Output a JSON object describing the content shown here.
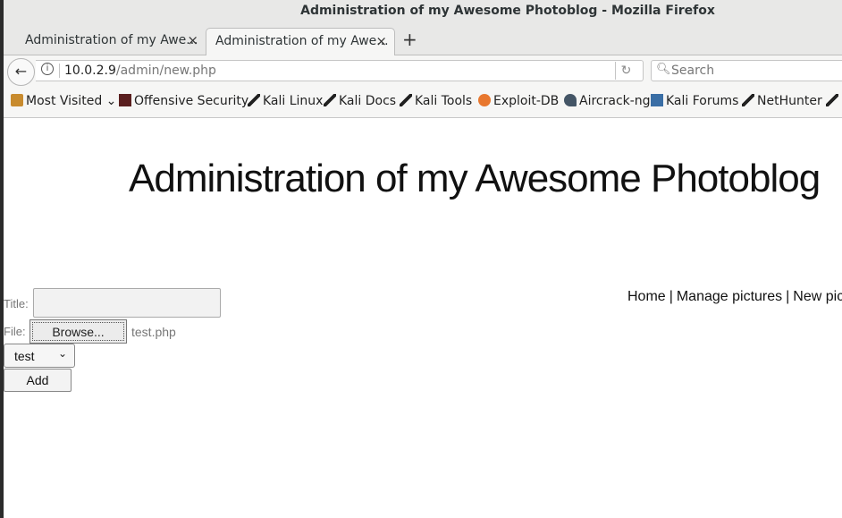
{
  "window": {
    "title": "Administration of my Awesome Photoblog - Mozilla Firefox"
  },
  "tabs": [
    {
      "label": "Administration of my Awe...",
      "active": false
    },
    {
      "label": "Administration of my Awe...",
      "active": true
    }
  ],
  "tab_close_glyph": "×",
  "new_tab_glyph": "+",
  "navbar": {
    "url_host": "10.0.2.9",
    "url_path": "/admin/new.php",
    "search_placeholder": "Search"
  },
  "bookmarks": [
    {
      "label": "Most Visited",
      "icon": "folder-icon",
      "dropdown": true
    },
    {
      "label": "Offensive Security",
      "icon": "offsec-icon"
    },
    {
      "label": "Kali Linux",
      "icon": "kali-dragon-icon"
    },
    {
      "label": "Kali Docs",
      "icon": "kali-dragon-icon"
    },
    {
      "label": "Kali Tools",
      "icon": "kali-dragon-icon"
    },
    {
      "label": "Exploit-DB",
      "icon": "exploitdb-icon"
    },
    {
      "label": "Aircrack-ng",
      "icon": "aircrack-icon"
    },
    {
      "label": "Kali Forums",
      "icon": "kali-forums-icon"
    },
    {
      "label": "NetHunter",
      "icon": "kali-dragon-icon"
    }
  ],
  "page": {
    "heading": "Administration of my Awesome Photoblog",
    "menu": {
      "home": "Home",
      "manage": "Manage pictures",
      "new": "New picture",
      "separator": "|"
    },
    "form": {
      "title_label": "Title:",
      "title_value": "",
      "file_label": "File:",
      "browse_label": "Browse...",
      "file_name": "test.php",
      "category_value": "test",
      "add_label": "Add"
    }
  }
}
